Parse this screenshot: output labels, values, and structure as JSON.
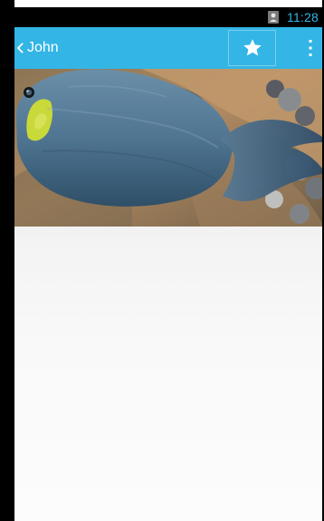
{
  "status_bar": {
    "time": "11:28",
    "notification_icon": "contact-icon"
  },
  "action_bar": {
    "title": "John",
    "back_icon": "chevron-left-icon",
    "star_icon": "star-icon",
    "overflow_icon": "more-vertical-icon"
  },
  "photo": {
    "subject": "fish-photo"
  },
  "colors": {
    "accent": "#33b5e5",
    "status_bar_bg": "#000000",
    "content_bg": "#f7f7f7"
  }
}
